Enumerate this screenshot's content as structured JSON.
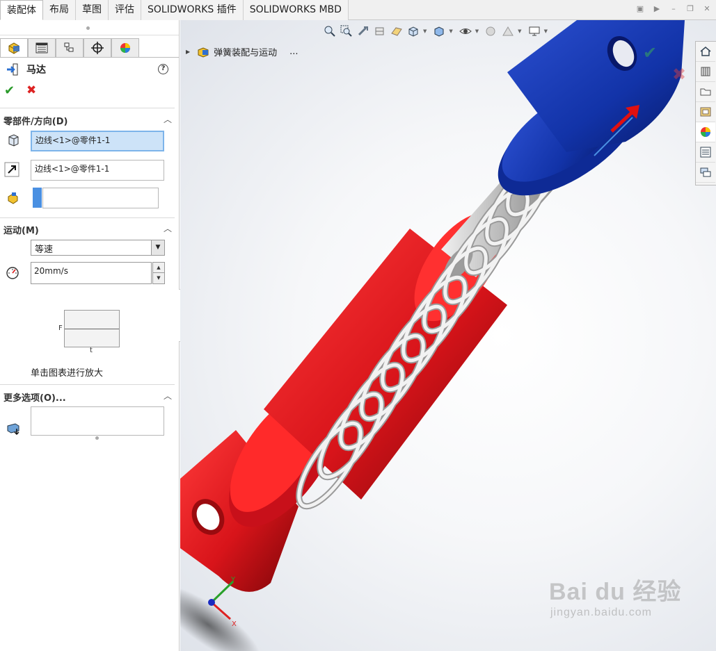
{
  "tabs": [
    {
      "label": "装配体",
      "active": true
    },
    {
      "label": "布局"
    },
    {
      "label": "草图"
    },
    {
      "label": "评估"
    },
    {
      "label": "SOLIDWORKS 插件"
    },
    {
      "label": "SOLIDWORKS MBD"
    }
  ],
  "property_manager": {
    "title": "马达",
    "help": "?",
    "ok_symbol": "✔",
    "cancel_symbol": "✖",
    "sections": {
      "component": {
        "header": "零部件/方向(D)",
        "component_field": "边线<1>@零件1-1",
        "direction_field": "边线<1>@零件1-1",
        "relative_field": ""
      },
      "motion": {
        "header": "运动(M)",
        "type_selected": "等速",
        "speed_value": "20mm/s",
        "graph_y_label": "F",
        "graph_x_label": "t",
        "graph_caption": "单击图表进行放大"
      },
      "more": {
        "header": "更多选项(O)...",
        "load_field": ""
      }
    }
  },
  "graphics": {
    "tree_item": "弹簧装配与运动",
    "tree_ellipsis": "...",
    "triad_labels": {
      "x": "X",
      "y": "Y"
    },
    "watermark": {
      "top": "Bai  du 经验",
      "bottom": "jingyan.baidu.com"
    }
  },
  "colors": {
    "red_part": "#d8141a",
    "blue_part": "#1233a8",
    "spring": "#d0d0d0",
    "accent": "#2a9a2a"
  }
}
